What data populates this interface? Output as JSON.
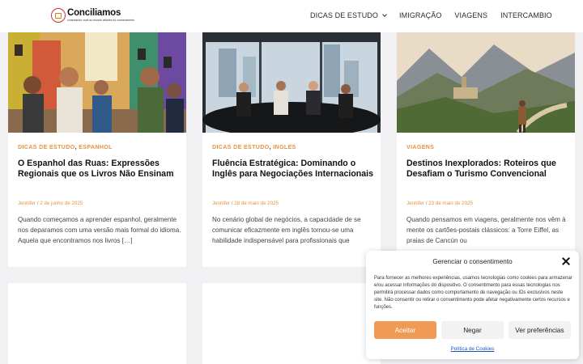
{
  "site": {
    "name": "Conciliamos",
    "tagline": "conectando você ao mundo através do conhecimento"
  },
  "nav": {
    "items": [
      "DICAS DE ESTUDO",
      "IMIGRAÇÃO",
      "VIAGENS",
      "INTERCAMBIO"
    ]
  },
  "posts": [
    {
      "categories": [
        "DICAS DE ESTUDO",
        "ESPANHOL"
      ],
      "title": "O Espanhol das Ruas: Expressões Regionais que os Livros Não Ensinam",
      "author": "Jennifer",
      "date": "2 de junho de 2025",
      "excerpt": "Quando começamos a aprender espanhol, geralmente nos deparamos com uma versão mais formal do idioma. Aquela que encontramos nos livros […]"
    },
    {
      "categories": [
        "DICAS DE ESTUDO",
        "INGLES"
      ],
      "title": "Fluência Estratégica: Dominando o Inglês para Negociações Internacionais",
      "author": "Jennifer",
      "date": "28 de maio de 2025",
      "excerpt": "No cenário global de negócios, a capacidade de se comunicar eficazmente em inglês tornou-se uma habilidade indispensável para profissionais que"
    },
    {
      "categories": [
        "VIAGENS"
      ],
      "title": "Destinos Inexplorados: Roteiros que Desafiam o Turismo Convencional",
      "author": "Jennifer",
      "date": "23 de maio de 2025",
      "excerpt": "Quando pensamos em viagens, geralmente nos vêm à mente os cartões-postais clássicos: a Torre Eiffel, as praias de Cancún ou"
    }
  ],
  "meta_separator": "/",
  "category_separator": ",",
  "cookie": {
    "title": "Gerenciar o consentimento",
    "body": "Para fornecer as melhores experiências, usamos tecnologias como cookies para armazenar e/ou acessar informações do dispositivo. O consentimento para essas tecnologias nos permitirá processar dados como comportamento de navegação ou IDs exclusivos neste site. Não consentir ou retirar o consentimento pode afetar negativamente certos recursos e funções.",
    "accept": "Aceitar",
    "deny": "Negar",
    "preferences": "Ver preferências",
    "policy": "Política de Cookies"
  },
  "colors": {
    "accent": "#e8923c",
    "accept_button": "#f09b55",
    "link": "#1a55c4",
    "background": "#f1f1f3"
  },
  "icons": [
    "logo-icon",
    "chevron-down-icon",
    "close-icon"
  ]
}
